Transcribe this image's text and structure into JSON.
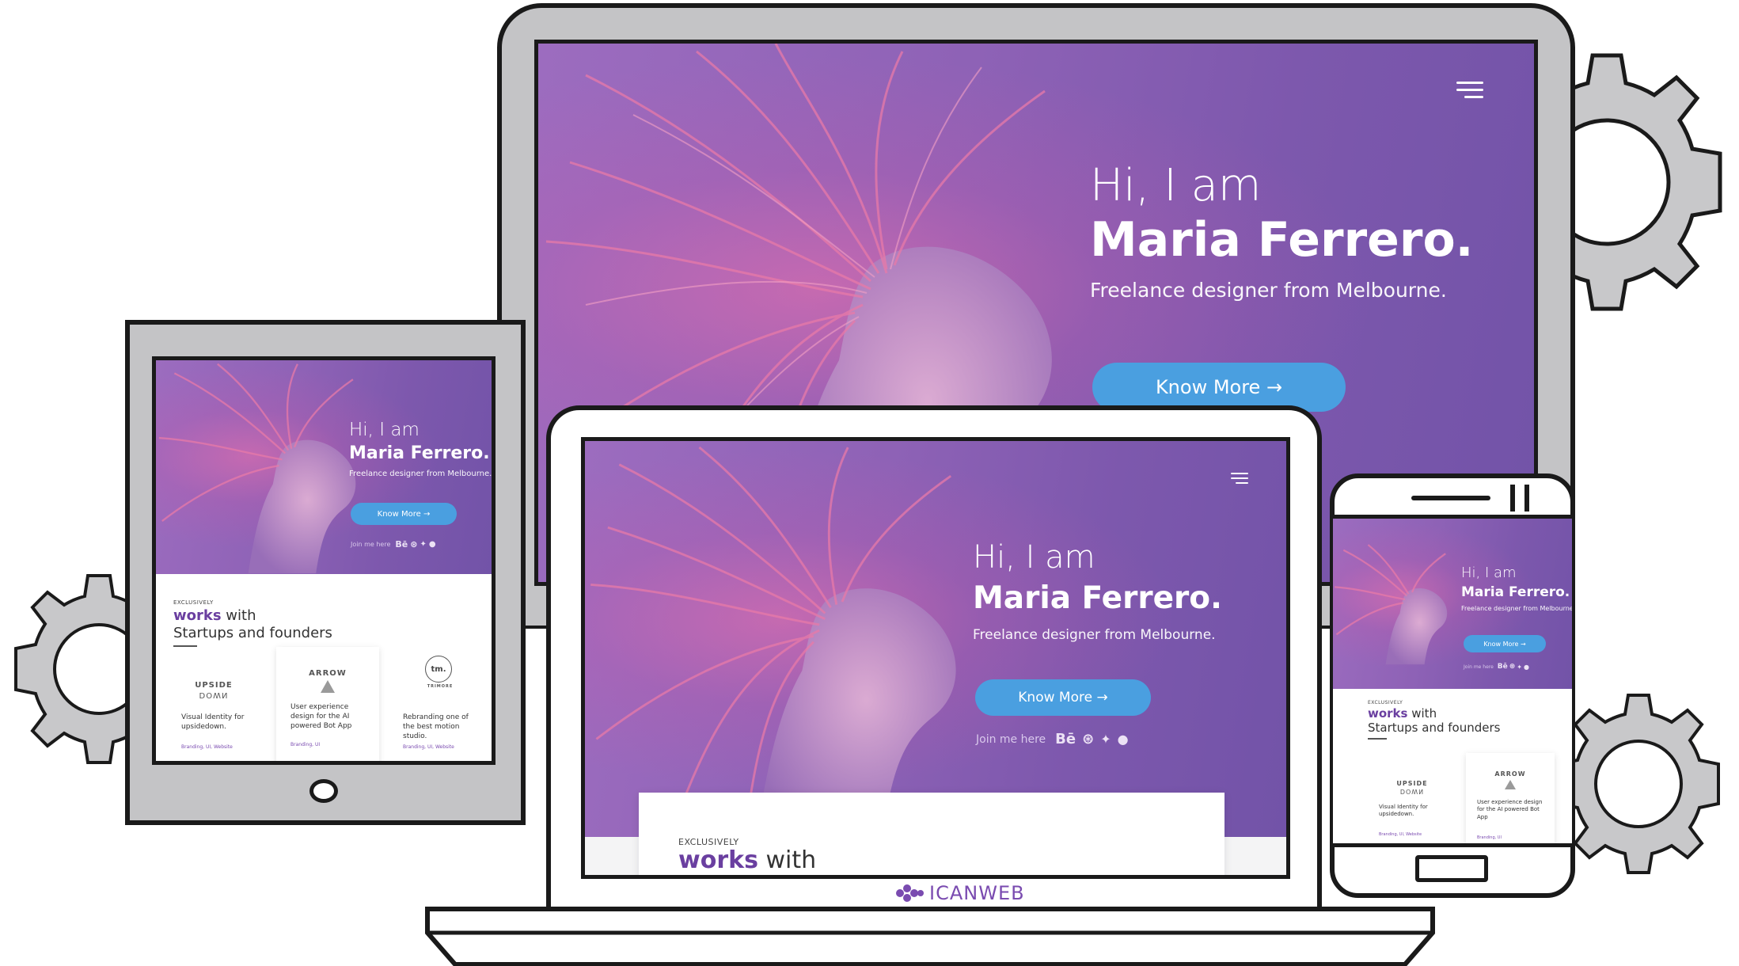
{
  "hero": {
    "hi": "Hi, I am",
    "name": "Maria Ferrero.",
    "tagline": "Freelance designer from Melbourne.",
    "cta": "Know More →",
    "join": "Join me here"
  },
  "social_icons": [
    "behance-icon",
    "dribbble-icon",
    "twitter-icon",
    "github-icon"
  ],
  "works": {
    "exclusively": "EXCLUSIVELY",
    "works": "works",
    "with": "with",
    "startups": "Startups and founders"
  },
  "cards": [
    {
      "logo": "UPSIDE",
      "logo_flip": "DOWN",
      "desc": "Visual Identity for upsidedown.",
      "tags": "Branding, UI, Website"
    },
    {
      "logo": "ARROW",
      "desc": "User experience design for the AI powered Bot App",
      "tags": "Branding, UI"
    },
    {
      "logo": "tm.",
      "logo_sub": "TRIMORE",
      "desc": "Rebranding one of the best motion studio.",
      "tags": "Branding, UI, Website"
    }
  ],
  "brand": "ICANWEB",
  "colors": {
    "hero_purple": "#8a60b4",
    "button_blue": "#4a9fe0",
    "accent_purple": "#6a3fa0",
    "device_frame": "#1a1a1a",
    "device_gray": "#c4c4c6"
  }
}
